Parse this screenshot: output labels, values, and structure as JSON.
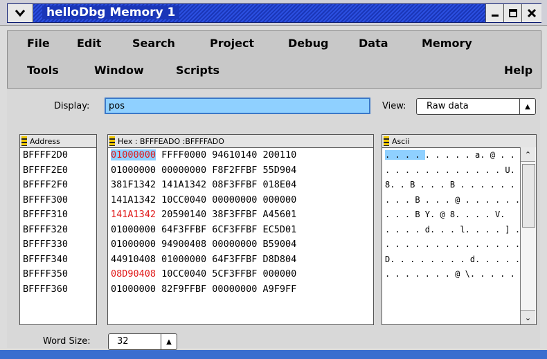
{
  "window": {
    "title": "helloDbg Memory 1",
    "buttons": [
      "minimize",
      "maximize",
      "close"
    ]
  },
  "menubar": {
    "row1": [
      "File",
      "Edit",
      "Search",
      "Project",
      "Debug",
      "Data",
      "Memory"
    ],
    "row2": [
      "Tools",
      "Window",
      "Scripts"
    ],
    "help": "Help"
  },
  "controls": {
    "display_label": "Display:",
    "display_value": "pos",
    "view_label": "View:",
    "view_value": "Raw data",
    "wordsize_label": "Word Size:",
    "wordsize_value": "32"
  },
  "columns": {
    "address_header": "Address",
    "hex_header": "Hex : BFFFEADO :BFFFFADO",
    "ascii_header": "Ascii"
  },
  "rows": [
    {
      "address": "BFFFF2D0",
      "w1": "01000000",
      "rest": " FFFF0000 94610140 200110",
      "ascii": ". . . .  . . . . . a. @   . ."
    },
    {
      "address": "BFFFF2E0",
      "w1": "01000000",
      "rest": " 00000000 F8F2FFBF 55D904",
      "ascii": ". . . . . . . . . . . . U. ."
    },
    {
      "address": "BFFFF2F0",
      "w1": "381F1342",
      "rest": " 141A1342 08F3FFBF 018E04",
      "ascii": "8. . B . . . B . . . . . . . ."
    },
    {
      "address": "BFFFF300",
      "w1": "141A1342",
      "rest": " 10CC0040 00000000 000000",
      "ascii": ". . . B . . . @ . . . . . . . ."
    },
    {
      "address": "BFFFF310",
      "w1": "141A1342",
      "rest": " 20590140 38F3FFBF A45601",
      "ascii": ". . . B   Y. @ 8. . . . V."
    },
    {
      "address": "BFFFF320",
      "w1": "01000000",
      "rest": " 64F3FFBF 6CF3FFBF EC5D01",
      "ascii": ". . . .  d. . .  l. . . . ] ."
    },
    {
      "address": "BFFFF330",
      "w1": "01000000",
      "rest": " 94900408 00000000 B59004",
      "ascii": ". . . . . . . . . . . . . . . ."
    },
    {
      "address": "BFFFF340",
      "w1": "44910408",
      "rest": " 01000000 64F3FFBF D8D804",
      "ascii": "D. . . . . . . .  d. . . . . ."
    },
    {
      "address": "BFFFF350",
      "w1": "08D90408",
      "rest": " 10CC0040 5CF3FFBF 000000",
      "ascii": ". . . . . . . @ \\. . . . . ."
    },
    {
      "address": "BFFFF360",
      "w1": "01000000",
      "rest": " 82F9FFBF 00000000 A9F9FF",
      "ascii": ""
    }
  ],
  "red_rows": [
    0,
    4,
    8
  ],
  "highlight_row": 0,
  "colors": {
    "titlebar": "#1f3fd0",
    "selection": "#8fd0ff",
    "changed_value": "#e01818"
  }
}
